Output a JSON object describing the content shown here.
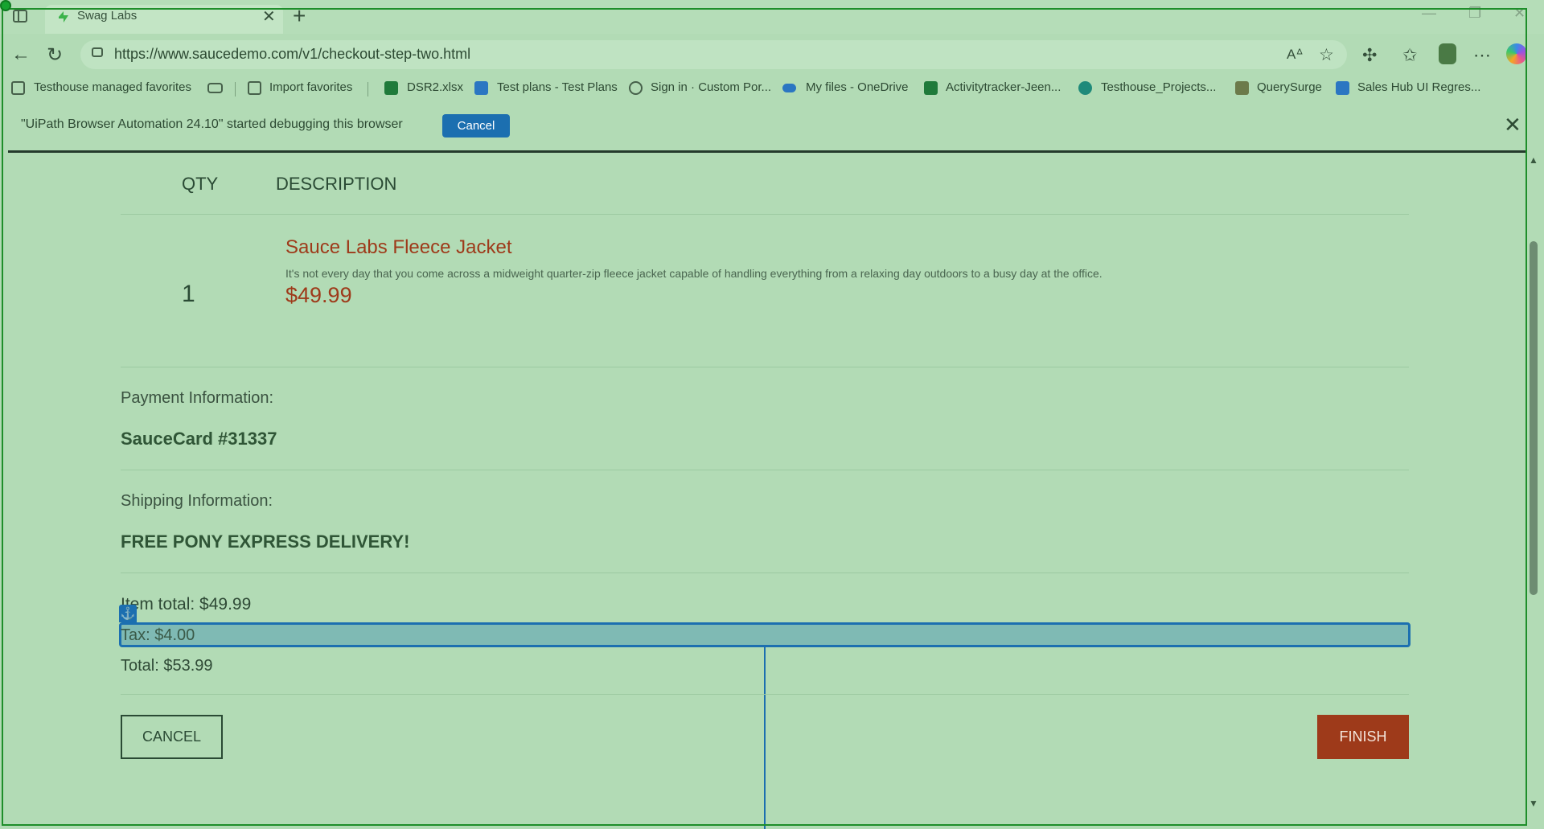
{
  "browser": {
    "tab_title": "Swag Labs",
    "url": "https://www.saucedemo.com/v1/checkout-step-two.html",
    "bookmarks": [
      "Testhouse managed favorites",
      "Import favorites",
      "DSR2.xlsx",
      "Test plans - Test Plans",
      "Sign in · Custom Por...",
      "My files - OneDrive",
      "Activitytracker-Jeen...",
      "Testhouse_Projects...",
      "QuerySurge",
      "Sales Hub UI Regres..."
    ]
  },
  "debug_bar": {
    "message": "\"UiPath Browser Automation 24.10\" started debugging this browser",
    "cancel_label": "Cancel"
  },
  "checkout": {
    "qty_header": "QTY",
    "description_header": "DESCRIPTION",
    "item": {
      "quantity": "1",
      "name": "Sauce Labs Fleece Jacket",
      "description": "It's not every day that you come across a midweight quarter-zip fleece jacket capable of handling everything from a relaxing day outdoors to a busy day at the office.",
      "price": "$49.99"
    },
    "payment_label": "Payment Information:",
    "payment_value": "SauceCard #31337",
    "shipping_label": "Shipping Information:",
    "shipping_value": "FREE PONY EXPRESS DELIVERY!",
    "item_total": "Item total: $49.99",
    "tax": "Tax: $4.00",
    "total": "Total: $53.99",
    "cancel_label": "CANCEL",
    "finish_label": "FINISH"
  }
}
